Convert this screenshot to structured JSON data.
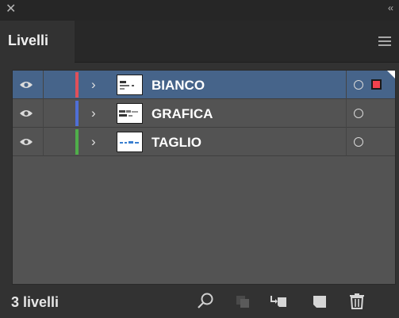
{
  "window": {
    "close_icon": "close-icon",
    "collapse_glyph": "‹‹"
  },
  "panel": {
    "tab_label": "Livelli",
    "menu_icon": "hamburger-menu-icon"
  },
  "layers": [
    {
      "name": "BIANCO",
      "color": "#e0505a",
      "selected": true,
      "selection_color": "#f2424e"
    },
    {
      "name": "GRAFICA",
      "color": "#4f6fd6",
      "selected": false
    },
    {
      "name": "TAGLIO",
      "color": "#4fae4a",
      "selected": false
    }
  ],
  "footer": {
    "count_label": "3 livelli",
    "icons": [
      "search-icon",
      "make-clipping-mask-icon",
      "move-to-layer-icon",
      "new-sublayer-icon",
      "delete-icon"
    ]
  },
  "colors": {
    "selected_row": "#46648a",
    "panel_bg": "#323232",
    "list_bg": "#535353"
  }
}
